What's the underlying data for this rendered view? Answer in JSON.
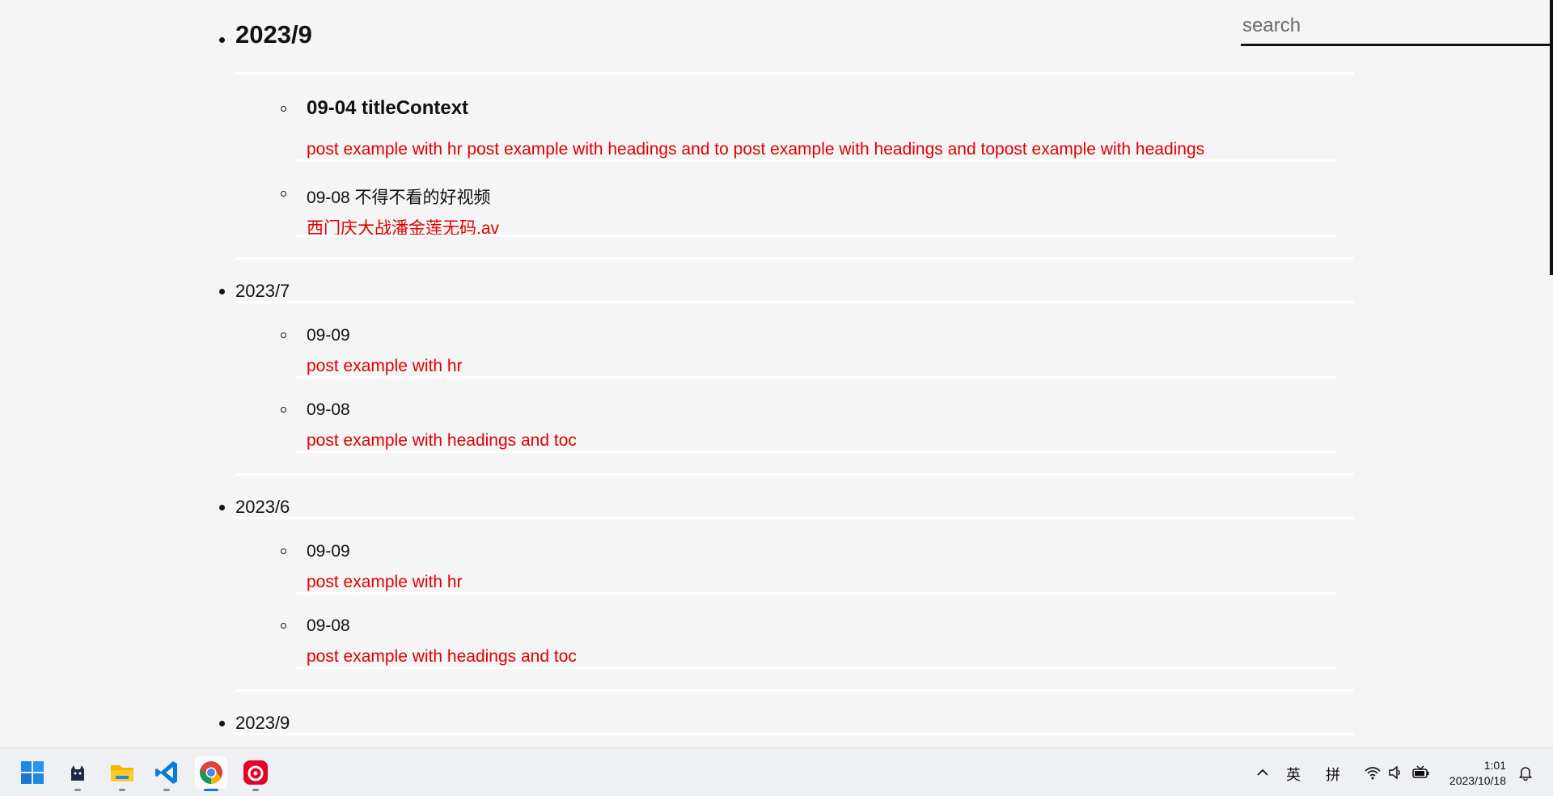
{
  "search": {
    "placeholder": "search"
  },
  "months": [
    {
      "title": "2023/9",
      "posts": [
        {
          "date_title": "09-04 titleContext",
          "description": "post example with hr post example with headings and to post example with headings and topost example with headings"
        },
        {
          "date_title": "09-08 不得不看的好视频",
          "description": "西门庆大战潘金莲无码.av"
        }
      ]
    },
    {
      "title": "2023/7",
      "posts": [
        {
          "date_title": "09-09",
          "description": "post example with hr"
        },
        {
          "date_title": "09-08",
          "description": "post example with headings and toc"
        }
      ]
    },
    {
      "title": "2023/6",
      "posts": [
        {
          "date_title": "09-09",
          "description": "post example with hr"
        },
        {
          "date_title": "09-08",
          "description": "post example with headings and toc"
        }
      ]
    },
    {
      "title": "2023/9",
      "posts": []
    }
  ],
  "taskbar": {
    "apps": [
      "windows-start",
      "cat-app",
      "file-explorer",
      "vscode",
      "chrome",
      "netease-music"
    ],
    "tray": {
      "ime_lang": "英",
      "ime_mode": "拼",
      "time": "1:01",
      "date": "2023/10/18"
    }
  },
  "colors": {
    "link": "#e00000",
    "background": "#f5f5f5",
    "rule": "#ffffff"
  }
}
